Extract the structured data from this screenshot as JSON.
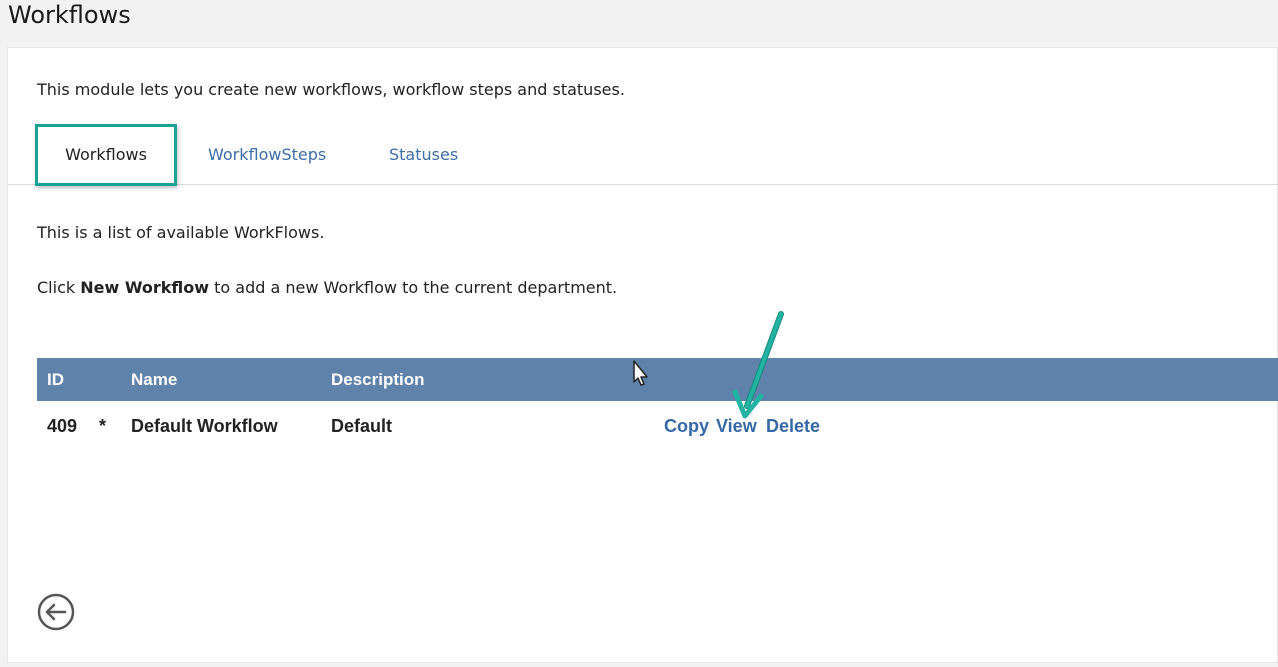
{
  "page": {
    "title": "Workflows"
  },
  "intro": "This module lets you create new workflows, workflow steps and statuses.",
  "tabs": [
    {
      "label": "Workflows",
      "active": true
    },
    {
      "label": "WorkflowSteps",
      "active": false
    },
    {
      "label": "Statuses",
      "active": false
    }
  ],
  "info": {
    "line1": "This is a list of available WorkFlows.",
    "line2_prefix": "Click ",
    "line2_bold": "New Workflow",
    "line2_suffix": " to add a new Workflow to the current department."
  },
  "grid": {
    "headers": {
      "id": "ID",
      "name": "Name",
      "description": "Description"
    },
    "rows": [
      {
        "id": "409",
        "default_marker": "*",
        "name": "Default Workflow",
        "description": "Default",
        "actions": {
          "copy": "Copy",
          "view": "View",
          "delete": "Delete"
        }
      }
    ]
  },
  "icons": {
    "back": "back-arrow-circle-icon",
    "cursor": "mouse-pointer-icon",
    "annotation": "annotation-arrow-icon"
  },
  "colors": {
    "header_bg": "#5f82aa",
    "link": "#3569a5",
    "tab_highlight": "#1aa394"
  }
}
